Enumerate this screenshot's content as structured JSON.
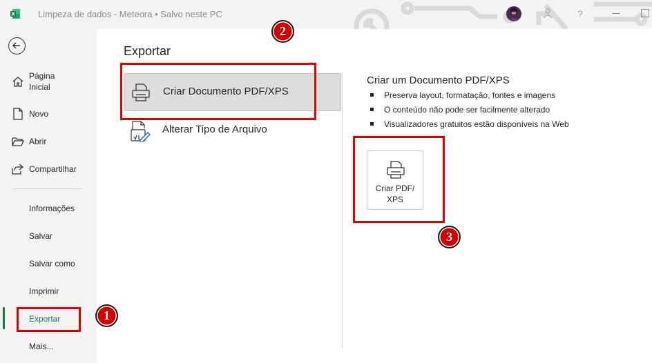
{
  "window": {
    "title": "Limpeza de dados  -  Meteora  •  Salvo neste PC",
    "help_label": "?"
  },
  "sidebar": {
    "items": [
      {
        "label": "Página\nInicial",
        "icon": "home-icon"
      },
      {
        "label": "Novo",
        "icon": "new-document-icon"
      },
      {
        "label": "Abrir",
        "icon": "folder-open-icon"
      },
      {
        "label": "Compartilhar",
        "icon": "share-icon"
      },
      {
        "label": "Informações"
      },
      {
        "label": "Salvar"
      },
      {
        "label": "Salvar como"
      },
      {
        "label": "Imprimir"
      },
      {
        "label": "Exportar",
        "active": true
      },
      {
        "label": "Mais..."
      }
    ]
  },
  "main": {
    "title": "Exportar",
    "options": [
      {
        "label": "Criar Documento PDF/XPS",
        "icon": "printer-icon",
        "selected": true
      },
      {
        "label": "Alterar Tipo de Arquivo",
        "icon": "change-file-type-icon",
        "selected": false
      }
    ],
    "detail": {
      "title": "Criar um Documento PDF/XPS",
      "bullets": [
        "Preserva layout, formatação, fontes e imagens",
        "O conteúdo não pode ser facilmente alterado",
        "Visualizadores gratuitos estão disponíveis na Web"
      ],
      "button_label": "Criar PDF/\nXPS"
    }
  },
  "annotations": {
    "badges": [
      "1",
      "2",
      "3"
    ],
    "highlight_color": "#e00000"
  },
  "colors": {
    "accent": "#107c41",
    "sidebar_bg": "#f3f3f3",
    "selected_bg": "#dddddd"
  }
}
